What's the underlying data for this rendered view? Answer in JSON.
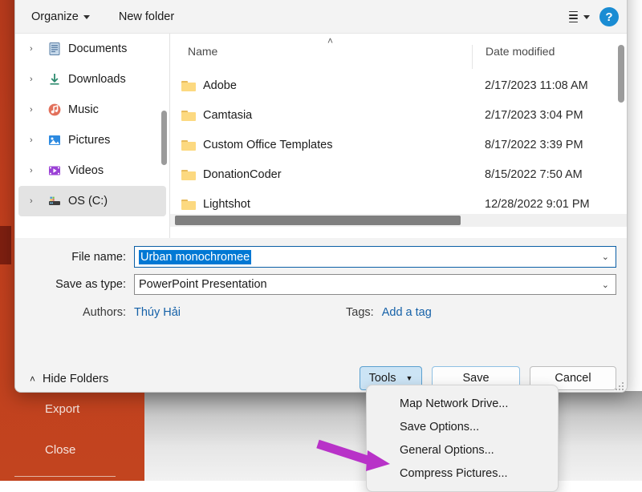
{
  "backstage": {
    "items": [
      {
        "label": "Export",
        "name": "rail-export"
      },
      {
        "label": "Close",
        "name": "rail-close"
      }
    ]
  },
  "dialog": {
    "toolbar": {
      "organize_label": "Organize",
      "new_folder_label": "New folder",
      "view_icon": "view-options-icon",
      "view_caret": "chevron-down-icon",
      "help_label": "?",
      "help_icon": "help-icon"
    },
    "nav_pane": {
      "items": [
        {
          "label": "Documents",
          "icon": "documents-icon",
          "selected": false
        },
        {
          "label": "Downloads",
          "icon": "downloads-icon",
          "selected": false
        },
        {
          "label": "Music",
          "icon": "music-icon",
          "selected": false
        },
        {
          "label": "Pictures",
          "icon": "pictures-icon",
          "selected": false
        },
        {
          "label": "Videos",
          "icon": "videos-icon",
          "selected": false
        },
        {
          "label": "OS (C:)",
          "icon": "drive-icon",
          "selected": true
        }
      ],
      "expand_chevron": "›"
    },
    "file_list": {
      "sort_indicator": "˄",
      "columns": [
        "Name",
        "Date modified"
      ],
      "rows": [
        {
          "name": "Adobe",
          "date": "2/17/2023 11:08 AM"
        },
        {
          "name": "Camtasia",
          "date": "2/17/2023 3:04 PM"
        },
        {
          "name": "Custom Office Templates",
          "date": "8/17/2022 3:39 PM"
        },
        {
          "name": "DonationCoder",
          "date": "8/15/2022 7:50 AM"
        },
        {
          "name": "Lightshot",
          "date": "12/28/2022 9:01 PM"
        }
      ]
    },
    "form": {
      "filename_label": "File name:",
      "filename_value": "Urban monochromee",
      "savetype_label": "Save as type:",
      "savetype_value": "PowerPoint Presentation",
      "authors_label": "Authors:",
      "authors_value": "Thúy Hải",
      "tags_label": "Tags:",
      "tags_value": "Add a tag",
      "combo_arrow": "⌄"
    },
    "footer": {
      "hide_folders_label": "Hide Folders",
      "hide_folders_chevron": "˄",
      "tools_label": "Tools",
      "tools_caret": "▼",
      "save_label": "Save",
      "cancel_label": "Cancel"
    },
    "tools_menu": {
      "items": [
        "Map Network Drive...",
        "Save Options...",
        "General Options...",
        "Compress Pictures..."
      ]
    }
  },
  "annotation": {
    "arrow_color": "#b832c8",
    "points_to": "Compress Pictures..."
  }
}
